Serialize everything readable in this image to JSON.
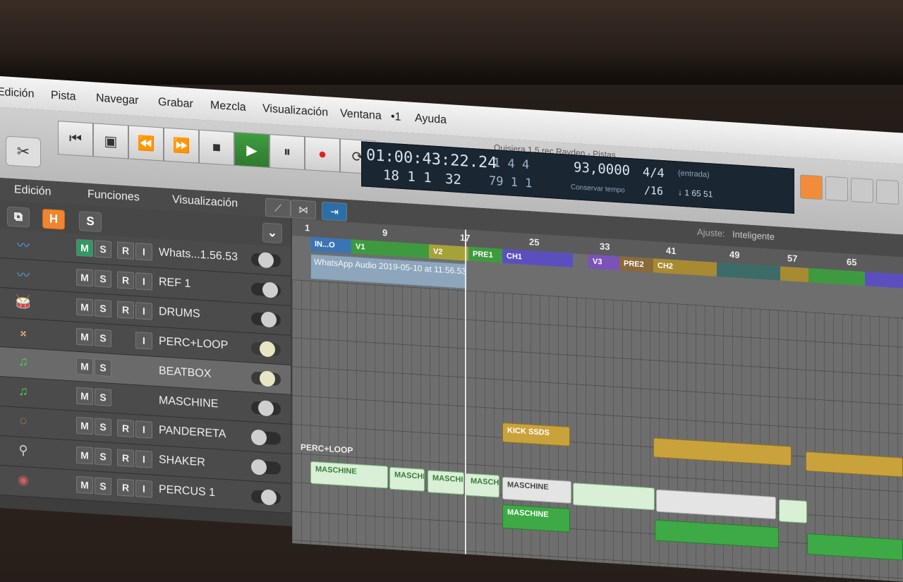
{
  "menubar": {
    "items": [
      "Edición",
      "Pista",
      "Navegar",
      "Grabar",
      "Mezcla",
      "Visualización",
      "Ventana",
      "•1",
      "Ayuda"
    ]
  },
  "window": {
    "title": "Quisiera 1.5 rec Rayden - Pistas"
  },
  "lcd": {
    "smpte": "01:00:43:22.24",
    "bars": "18 1 1",
    "ticks": "32",
    "pos_top": "1 4 4",
    "pos_bottom": "79 1 1",
    "tempo": "93,0000",
    "tempo_label": "Conservar tempo",
    "signature": "4/4",
    "division": "/16",
    "input_label": "(entrada)",
    "input_value": "↓ 1 65 51"
  },
  "toolbar": {
    "edicion": "Edición",
    "funciones": "Funciones",
    "visualizacion": "Visualización",
    "ajuste_label": "Ajuste:",
    "ajuste_value": "Inteligente"
  },
  "header_buttons": {
    "h": "H",
    "s": "S"
  },
  "tracks": [
    {
      "name": "Whats...1.56.53",
      "m": "M",
      "s": "S",
      "r": "R",
      "i": "I",
      "icon": "waveform-icon"
    },
    {
      "name": "REF 1",
      "m": "M",
      "s": "S",
      "r": "R",
      "i": "I",
      "icon": "waveform-icon"
    },
    {
      "name": "DRUMS",
      "m": "M",
      "s": "S",
      "r": "R",
      "i": "I",
      "icon": "drums-icon"
    },
    {
      "name": "PERC+LOOP",
      "m": "M",
      "s": "S",
      "r": "",
      "i": "I",
      "icon": "maracas-icon"
    },
    {
      "name": "BEATBOX",
      "m": "M",
      "s": "S",
      "r": "",
      "i": "",
      "icon": "music-note-icon"
    },
    {
      "name": "MASCHINE",
      "m": "M",
      "s": "S",
      "r": "",
      "i": "",
      "icon": "music-note-icon"
    },
    {
      "name": "PANDERETA",
      "m": "M",
      "s": "S",
      "r": "R",
      "i": "I",
      "icon": "tambourine-icon"
    },
    {
      "name": "SHAKER",
      "m": "M",
      "s": "S",
      "r": "R",
      "i": "I",
      "icon": "shaker-icon"
    },
    {
      "name": "PERCUS 1",
      "m": "M",
      "s": "S",
      "r": "R",
      "i": "I",
      "icon": "drum-icon"
    }
  ],
  "ruler": [
    "1",
    "9",
    "17",
    "25",
    "33",
    "41",
    "49",
    "57",
    "65"
  ],
  "markers": [
    {
      "label": "IN...O",
      "color": "#3b74b3"
    },
    {
      "label": "V1",
      "color": "#3f9a3f"
    },
    {
      "label": "V2",
      "color": "#a6a23a"
    },
    {
      "label": "PRE1",
      "color": "#3f9a3f"
    },
    {
      "label": "CH1",
      "color": "#5b4fc0"
    },
    {
      "label": "V3",
      "color": "#7a52b8"
    },
    {
      "label": "PRE2",
      "color": "#8a6a3a"
    },
    {
      "label": "CH2",
      "color": "#a88a32"
    }
  ],
  "audio_region": {
    "label": "WhatsApp Audio 2019-05-10 at 11.56.53"
  },
  "regions": {
    "kick": "KICK SSDS",
    "perc_loop": "PERC+LOOP",
    "maschine": "MASCHINE",
    "maschi": "MASCHI"
  }
}
